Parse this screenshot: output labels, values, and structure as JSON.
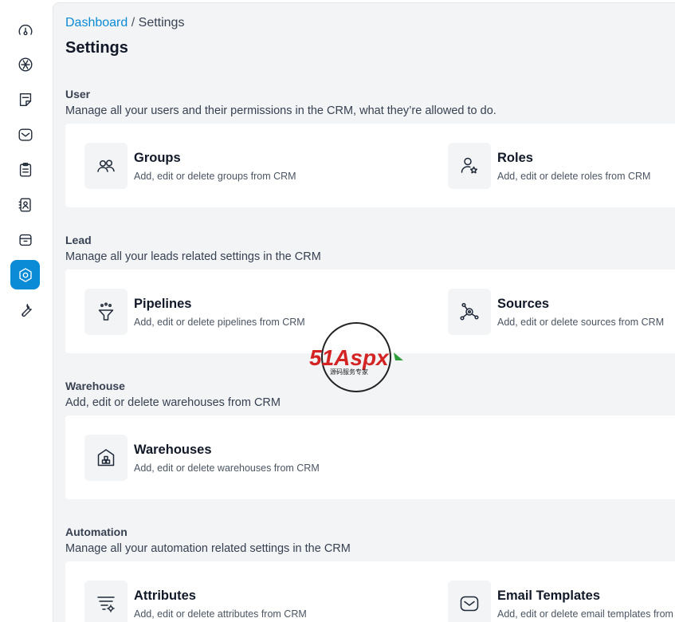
{
  "sidebar": {
    "items": [
      {
        "name": "dashboard",
        "icon": "gauge-icon",
        "active": false
      },
      {
        "name": "leads",
        "icon": "leads-icon",
        "active": false
      },
      {
        "name": "quotes",
        "icon": "sticky-note-icon",
        "active": false
      },
      {
        "name": "mail",
        "icon": "mail-icon",
        "active": false
      },
      {
        "name": "activities",
        "icon": "clipboard-icon",
        "active": false
      },
      {
        "name": "contacts",
        "icon": "contact-book-icon",
        "active": false
      },
      {
        "name": "products",
        "icon": "box-icon",
        "active": false
      },
      {
        "name": "settings",
        "icon": "settings-icon",
        "active": true
      },
      {
        "name": "configuration",
        "icon": "wrench-icon",
        "active": false
      }
    ],
    "active_color": "#0b8bd6"
  },
  "breadcrumb": {
    "link": "Dashboard",
    "separator": "/",
    "current": "Settings"
  },
  "page_title": "Settings",
  "sections": {
    "user": {
      "title": "User",
      "description": "Manage all your users and their permissions in the CRM, what they’re allowed to do.",
      "items": [
        {
          "name": "Groups",
          "description": "Add, edit or delete groups from CRM",
          "icon": "groups-icon"
        },
        {
          "name": "Roles",
          "description": "Add, edit or delete roles from CRM",
          "icon": "roles-icon"
        }
      ]
    },
    "lead": {
      "title": "Lead",
      "description": "Manage all your leads related settings in the CRM",
      "items": [
        {
          "name": "Pipelines",
          "description": "Add, edit or delete pipelines from CRM",
          "icon": "pipeline-funnel-icon"
        },
        {
          "name": "Sources",
          "description": "Add, edit or delete sources from CRM",
          "icon": "sources-network-icon"
        }
      ]
    },
    "warehouse": {
      "title": "Warehouse",
      "description": "Add, edit or delete warehouses from CRM",
      "items": [
        {
          "name": "Warehouses",
          "description": "Add, edit or delete warehouses from CRM",
          "icon": "warehouse-icon"
        }
      ]
    },
    "automation": {
      "title": "Automation",
      "description": "Manage all your automation related settings in the CRM",
      "items": [
        {
          "name": "Attributes",
          "description": "Add, edit or delete attributes from CRM",
          "icon": "attributes-icon"
        },
        {
          "name": "Email Templates",
          "description": "Add, edit or delete email templates from CRM",
          "icon": "email-template-icon"
        }
      ]
    }
  },
  "watermark": {
    "brand": "51Aspx",
    "tagline": "源码服务专家"
  }
}
